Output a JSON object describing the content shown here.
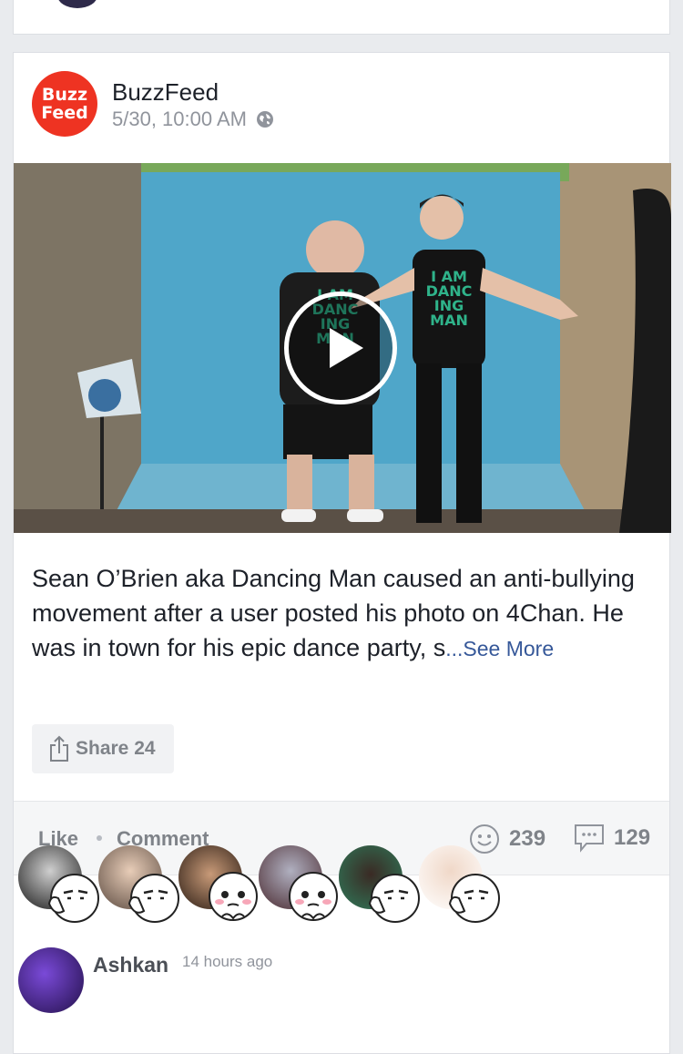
{
  "post": {
    "page_name": "BuzzFeed",
    "logo_line1": "Buzz",
    "logo_line2": "Feed",
    "timestamp": "5/30, 10:00 AM",
    "privacy_icon": "globe-icon",
    "description": "Sean O’Brien aka Dancing Man caused an anti-bullying movement after a user posted his photo on 4Chan. He was in town for his epic dance party, s",
    "see_more": "...See More",
    "share_label": "Share 24",
    "colors": {
      "brand": "#ee3322",
      "link": "#365899",
      "muted": "#7f8389"
    }
  },
  "video": {
    "shirt_text": [
      "I AM",
      "DANC",
      "ING",
      "MAN"
    ],
    "play_icon": "play-icon"
  },
  "actions": {
    "like": "Like",
    "comment": "Comment",
    "reactions_count": "239",
    "comments_count": "129"
  },
  "reactors": [
    {
      "name": "reactor-1",
      "emoji": "thumbs-up-face-icon"
    },
    {
      "name": "reactor-2",
      "emoji": "thumbs-up-face-icon"
    },
    {
      "name": "reactor-3",
      "emoji": "pleading-face-icon"
    },
    {
      "name": "reactor-4",
      "emoji": "pleading-face-icon"
    },
    {
      "name": "reactor-5",
      "emoji": "thumbs-up-face-icon"
    },
    {
      "name": "reactor-6",
      "emoji": "thumbs-up-face-icon"
    }
  ],
  "comment": {
    "author": "Ashkan",
    "time": "14 hours ago"
  }
}
